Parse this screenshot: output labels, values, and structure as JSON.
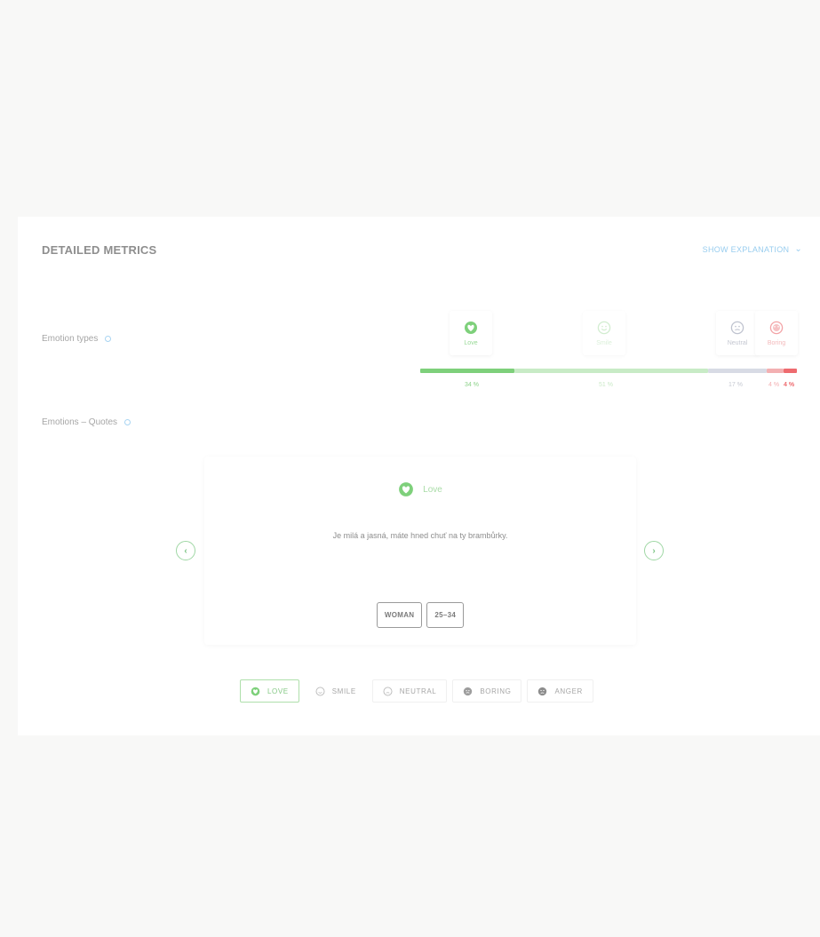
{
  "header": {
    "title": "DETAILED METRICS",
    "explanation": "SHOW EXPLANATION"
  },
  "rows": {
    "emotion_types": "Emotion types",
    "emotion_quotes": "Emotions – Quotes"
  },
  "emotions": [
    {
      "name": "Love",
      "percent": "34 %",
      "share": 34,
      "color": "#7ed07b",
      "icon": "heart-face-icon"
    },
    {
      "name": "Smile",
      "percent": "51 %",
      "share": 51,
      "color": "#bfe6bd",
      "icon": "smile-face-icon"
    },
    {
      "name": "Neutral",
      "percent": "17 %",
      "share": 17,
      "color": "#d8dbe5",
      "icon": "neutral-face-icon"
    },
    {
      "name": "Boring",
      "percent": "4 %",
      "share": 4,
      "color": "#f3a3a6",
      "icon": "boring-face-icon"
    },
    {
      "name": "Anger",
      "percent": "4 %",
      "share": 4,
      "color": "#ee6b6f",
      "icon": "anger-face-icon"
    }
  ],
  "quote": {
    "emotion": "Love",
    "text": "Je milá a jasná, máte hned chuť na ty brambůrky.",
    "tags": [
      "WOMAN",
      "25–34"
    ]
  },
  "filters": [
    "LOVE",
    "SMILE",
    "NEUTRAL",
    "BORING",
    "ANGER"
  ],
  "active_filter": "LOVE"
}
